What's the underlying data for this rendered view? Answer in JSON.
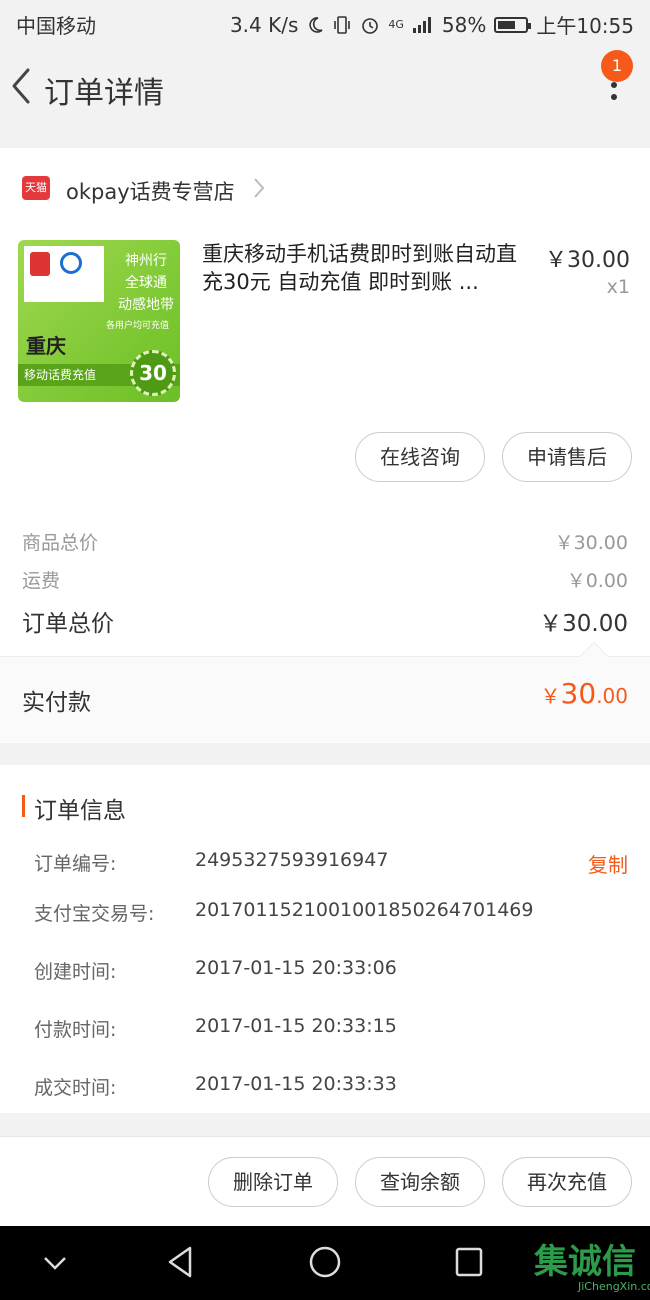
{
  "status_bar": {
    "carrier": "中国移动",
    "speed": "3.4 K/s",
    "network": "4G",
    "battery": "58%",
    "time": "上午10:55"
  },
  "nav": {
    "title": "订单详情",
    "badge_count": "1"
  },
  "shop": {
    "logo_text": "天猫",
    "name": "okpay话费专营店"
  },
  "product": {
    "image": {
      "slogan_1": "神州行",
      "slogan_2": "全球通",
      "slogan_3": "动感地带",
      "small_text": "各用户均可充值",
      "city": "重庆",
      "band": "移动话费充值",
      "amount": "30"
    },
    "title": "重庆移动手机话费即时到账自动直充30元 自动充值 即时到账 ...",
    "price": "￥30.00",
    "qty": "x1"
  },
  "item_actions": {
    "consult": "在线咨询",
    "after_sale": "申请售后"
  },
  "summary": {
    "goods_label": "商品总价",
    "goods_value": "￥30.00",
    "shipping_label": "运费",
    "shipping_value": "￥0.00",
    "total_label": "订单总价",
    "total_value": "￥30.00",
    "paid_label": "实付款",
    "paid_yen": "￥",
    "paid_int": "30",
    "paid_dec": ".00"
  },
  "order_info": {
    "title": "订单信息",
    "copy_label": "复制",
    "rows": [
      {
        "key": "订单编号:",
        "value": "2495327593916947"
      },
      {
        "key": "支付宝交易号:",
        "value": "2017011521001001850264701469"
      },
      {
        "key": "创建时间:",
        "value": "2017-01-15 20:33:06"
      },
      {
        "key": "付款时间:",
        "value": "2017-01-15 20:33:15"
      },
      {
        "key": "成交时间:",
        "value": "2017-01-15 20:33:33"
      }
    ]
  },
  "bottom_actions": {
    "delete": "删除订单",
    "query_balance": "查询余额",
    "recharge_again": "再次充值"
  },
  "watermark": {
    "big": "集诚信",
    "small": "JiChengXin.com"
  },
  "colors": {
    "accent": "#f55a1a",
    "tmall": "#e4393c"
  }
}
